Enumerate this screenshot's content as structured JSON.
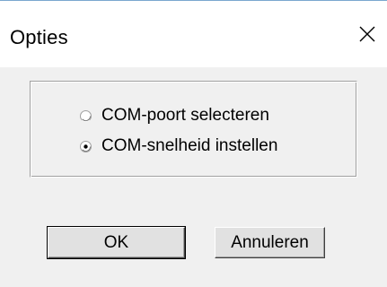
{
  "window": {
    "title": "Opties"
  },
  "options": {
    "items": [
      {
        "label": "COM-poort selecteren",
        "selected": false
      },
      {
        "label": "COM-snelheid instellen",
        "selected": true
      }
    ]
  },
  "buttons": {
    "ok_label": "OK",
    "cancel_label": "Annuleren"
  },
  "icons": {
    "close": "close-icon",
    "radio_unchecked": "radio-unchecked-icon",
    "radio_checked": "radio-checked-icon"
  },
  "colors": {
    "dialog_background": "#f0f0f0",
    "title_background": "#ffffff",
    "window_border": "#7aa7cf",
    "button_face": "#e1e1e1"
  }
}
